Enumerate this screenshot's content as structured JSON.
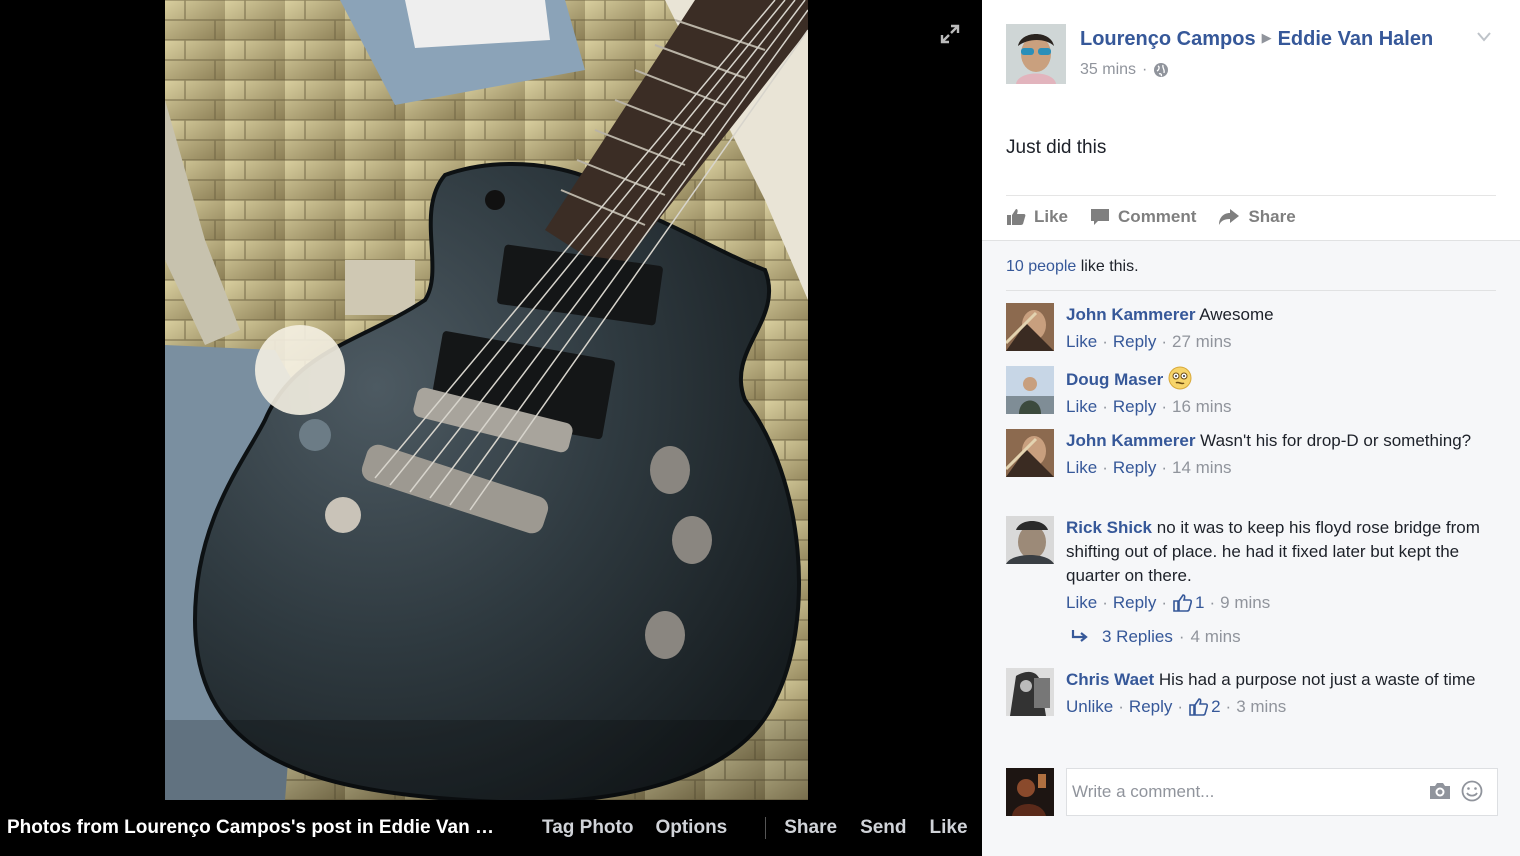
{
  "photo": {
    "caption": "Photos from Lourenço Campos's post in Eddie Van …",
    "tag_photo": "Tag Photo",
    "options": "Options",
    "share": "Share",
    "send": "Send",
    "like": "Like",
    "expand_icon": "expand-icon"
  },
  "post": {
    "author": "Lourenço Campos",
    "target": "Eddie Van Halen",
    "time": "35 mins",
    "privacy_icon": "globe-icon",
    "text": "Just did this",
    "actions": {
      "like": "Like",
      "comment": "Comment",
      "share": "Share"
    }
  },
  "likes": {
    "count_text": "10 people",
    "suffix": " like this."
  },
  "comments": [
    {
      "name": "John Kammerer",
      "text": "Awesome",
      "like": "Like",
      "reply": "Reply",
      "time": "27 mins"
    },
    {
      "name": "Doug Maser",
      "text": "",
      "emoji": "confused-face-emoji",
      "like": "Like",
      "reply": "Reply",
      "time": "16 mins"
    },
    {
      "name": "John Kammerer",
      "text": "Wasn't his for drop-D or something?",
      "like": "Like",
      "reply": "Reply",
      "time": "14 mins"
    },
    {
      "name": "Rick Shick",
      "text": "no it was to keep his floyd rose bridge from shifting out of place. he had it fixed later but kept the quarter on there.",
      "like": "Like",
      "reply": "Reply",
      "likes": "1",
      "time": "9 mins"
    },
    {
      "name": "Chris Waet",
      "text": "His had a purpose not just a waste of time",
      "like": "Unlike",
      "reply": "Reply",
      "likes": "2",
      "time": "3 mins"
    }
  ],
  "replies": {
    "label": "3 Replies",
    "time": "4 mins"
  },
  "composer": {
    "placeholder": "Write a comment..."
  },
  "colors": {
    "link": "#365899",
    "meta": "#90949c",
    "panel_bg": "#f6f7f9"
  }
}
